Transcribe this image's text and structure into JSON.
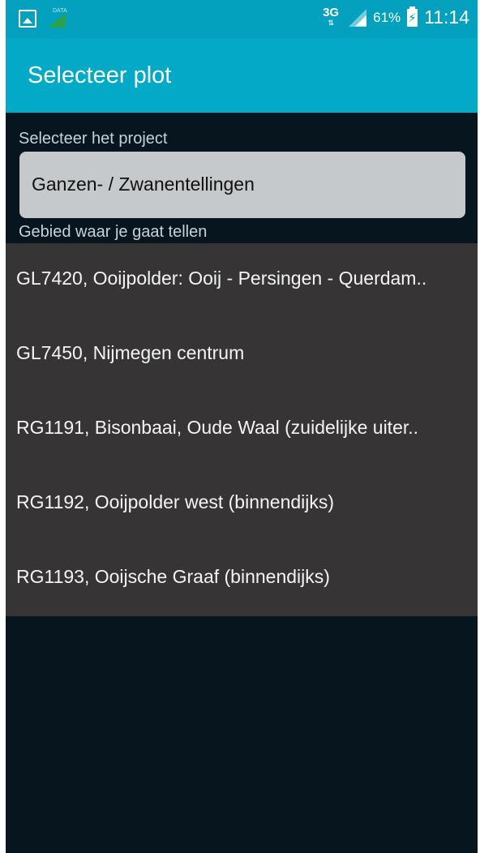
{
  "status_bar": {
    "network": "3G",
    "data_icon_text": "DATA",
    "battery_percent": "61%",
    "time": "11:14",
    "icons": [
      "gallery-icon",
      "data-transfer-icon",
      "signal-icon",
      "battery-charging-icon"
    ]
  },
  "action_bar": {
    "title": "Selecteer plot"
  },
  "project": {
    "label": "Selecteer het project",
    "selected": "Ganzen- / Zwanentellingen"
  },
  "area": {
    "label": "Gebied waar je gaat tellen",
    "items": [
      {
        "label": "GL7420, Ooijpolder: Ooij - Persingen - Querdam.."
      },
      {
        "label": "GL7450, Nijmegen centrum"
      },
      {
        "label": "RG1191, Bisonbaai, Oude Waal (zuidelijke uiter.."
      },
      {
        "label": "RG1192, Ooijpolder west (binnendijks)"
      },
      {
        "label": "RG1193, Ooijsche Graaf (binnendijks)"
      }
    ]
  },
  "colors": {
    "status_bar": "#03a1bd",
    "action_bar": "#03aac8",
    "background": "#07151e",
    "list_background": "#363434",
    "select_background": "#c5c9cb"
  }
}
